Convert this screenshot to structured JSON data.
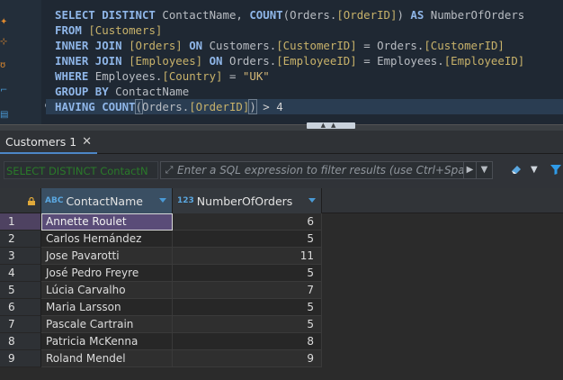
{
  "editor": {
    "lines": [
      [
        {
          "t": "SELECT DISTINCT ",
          "c": "kw"
        },
        {
          "t": "ContactName, ",
          "c": "id"
        },
        {
          "t": "COUNT",
          "c": "kw"
        },
        {
          "t": "(Orders.",
          "c": "id"
        },
        {
          "t": "[OrderID]",
          "c": "br"
        },
        {
          "t": ") ",
          "c": "id"
        },
        {
          "t": "AS ",
          "c": "kw"
        },
        {
          "t": "NumberOfOrders",
          "c": "id"
        }
      ],
      [
        {
          "t": "FROM ",
          "c": "kw"
        },
        {
          "t": "[Customers]",
          "c": "br"
        }
      ],
      [
        {
          "t": "INNER JOIN ",
          "c": "kw"
        },
        {
          "t": "[Orders] ",
          "c": "br"
        },
        {
          "t": "ON ",
          "c": "kw"
        },
        {
          "t": "Customers.",
          "c": "id"
        },
        {
          "t": "[CustomerID]",
          "c": "br"
        },
        {
          "t": " = Orders.",
          "c": "id"
        },
        {
          "t": "[CustomerID]",
          "c": "br"
        }
      ],
      [
        {
          "t": "INNER JOIN ",
          "c": "kw"
        },
        {
          "t": "[Employees] ",
          "c": "br"
        },
        {
          "t": "ON ",
          "c": "kw"
        },
        {
          "t": "Orders.",
          "c": "id"
        },
        {
          "t": "[EmployeeID]",
          "c": "br"
        },
        {
          "t": " = Employees.",
          "c": "id"
        },
        {
          "t": "[EmployeeID]",
          "c": "br"
        }
      ],
      [
        {
          "t": "WHERE ",
          "c": "kw"
        },
        {
          "t": "Employees.",
          "c": "id"
        },
        {
          "t": "[Country]",
          "c": "br"
        },
        {
          "t": " = ",
          "c": "id"
        },
        {
          "t": "\"UK\"",
          "c": "st"
        }
      ],
      [
        {
          "t": "GROUP BY ",
          "c": "kw"
        },
        {
          "t": "ContactName",
          "c": "id"
        }
      ],
      [
        {
          "t": "HAVING ",
          "c": "kw"
        },
        {
          "t": "COUNT",
          "c": "kw"
        },
        {
          "t": "(",
          "c": "id bh"
        },
        {
          "t": "Orders.",
          "c": "id"
        },
        {
          "t": "[OrderID]",
          "c": "br"
        },
        {
          "t": ")",
          "c": "id bh"
        },
        {
          "t": " > 4",
          "c": "nm"
        }
      ]
    ],
    "active_line": 6
  },
  "tab": {
    "label": "Customers 1",
    "close": "✕"
  },
  "filter": {
    "query_preview": "SELECT DISTINCT ContactN",
    "placeholder": "Enter a SQL expression to filter results (use Ctrl+Space)"
  },
  "grid": {
    "columns": [
      {
        "type": "ABC",
        "name": "ContactName"
      },
      {
        "type": "123",
        "name": "NumberOfOrders"
      }
    ],
    "rows": [
      {
        "n": "1",
        "name": "Annette Roulet",
        "count": "6"
      },
      {
        "n": "2",
        "name": "Carlos Hernández",
        "count": "5"
      },
      {
        "n": "3",
        "name": "Jose Pavarotti",
        "count": "11"
      },
      {
        "n": "4",
        "name": "José Pedro Freyre",
        "count": "5"
      },
      {
        "n": "5",
        "name": "Lúcia Carvalho",
        "count": "7"
      },
      {
        "n": "6",
        "name": "Maria Larsson",
        "count": "5"
      },
      {
        "n": "7",
        "name": "Pascale Cartrain",
        "count": "5"
      },
      {
        "n": "8",
        "name": "Patricia McKenna",
        "count": "8"
      },
      {
        "n": "9",
        "name": "Roland Mendel",
        "count": "9"
      }
    ],
    "selected_row": 0
  },
  "colors": {
    "accent": "#4c86c6",
    "selection": "#5a4c78",
    "keyword": "#8fb6e8"
  }
}
